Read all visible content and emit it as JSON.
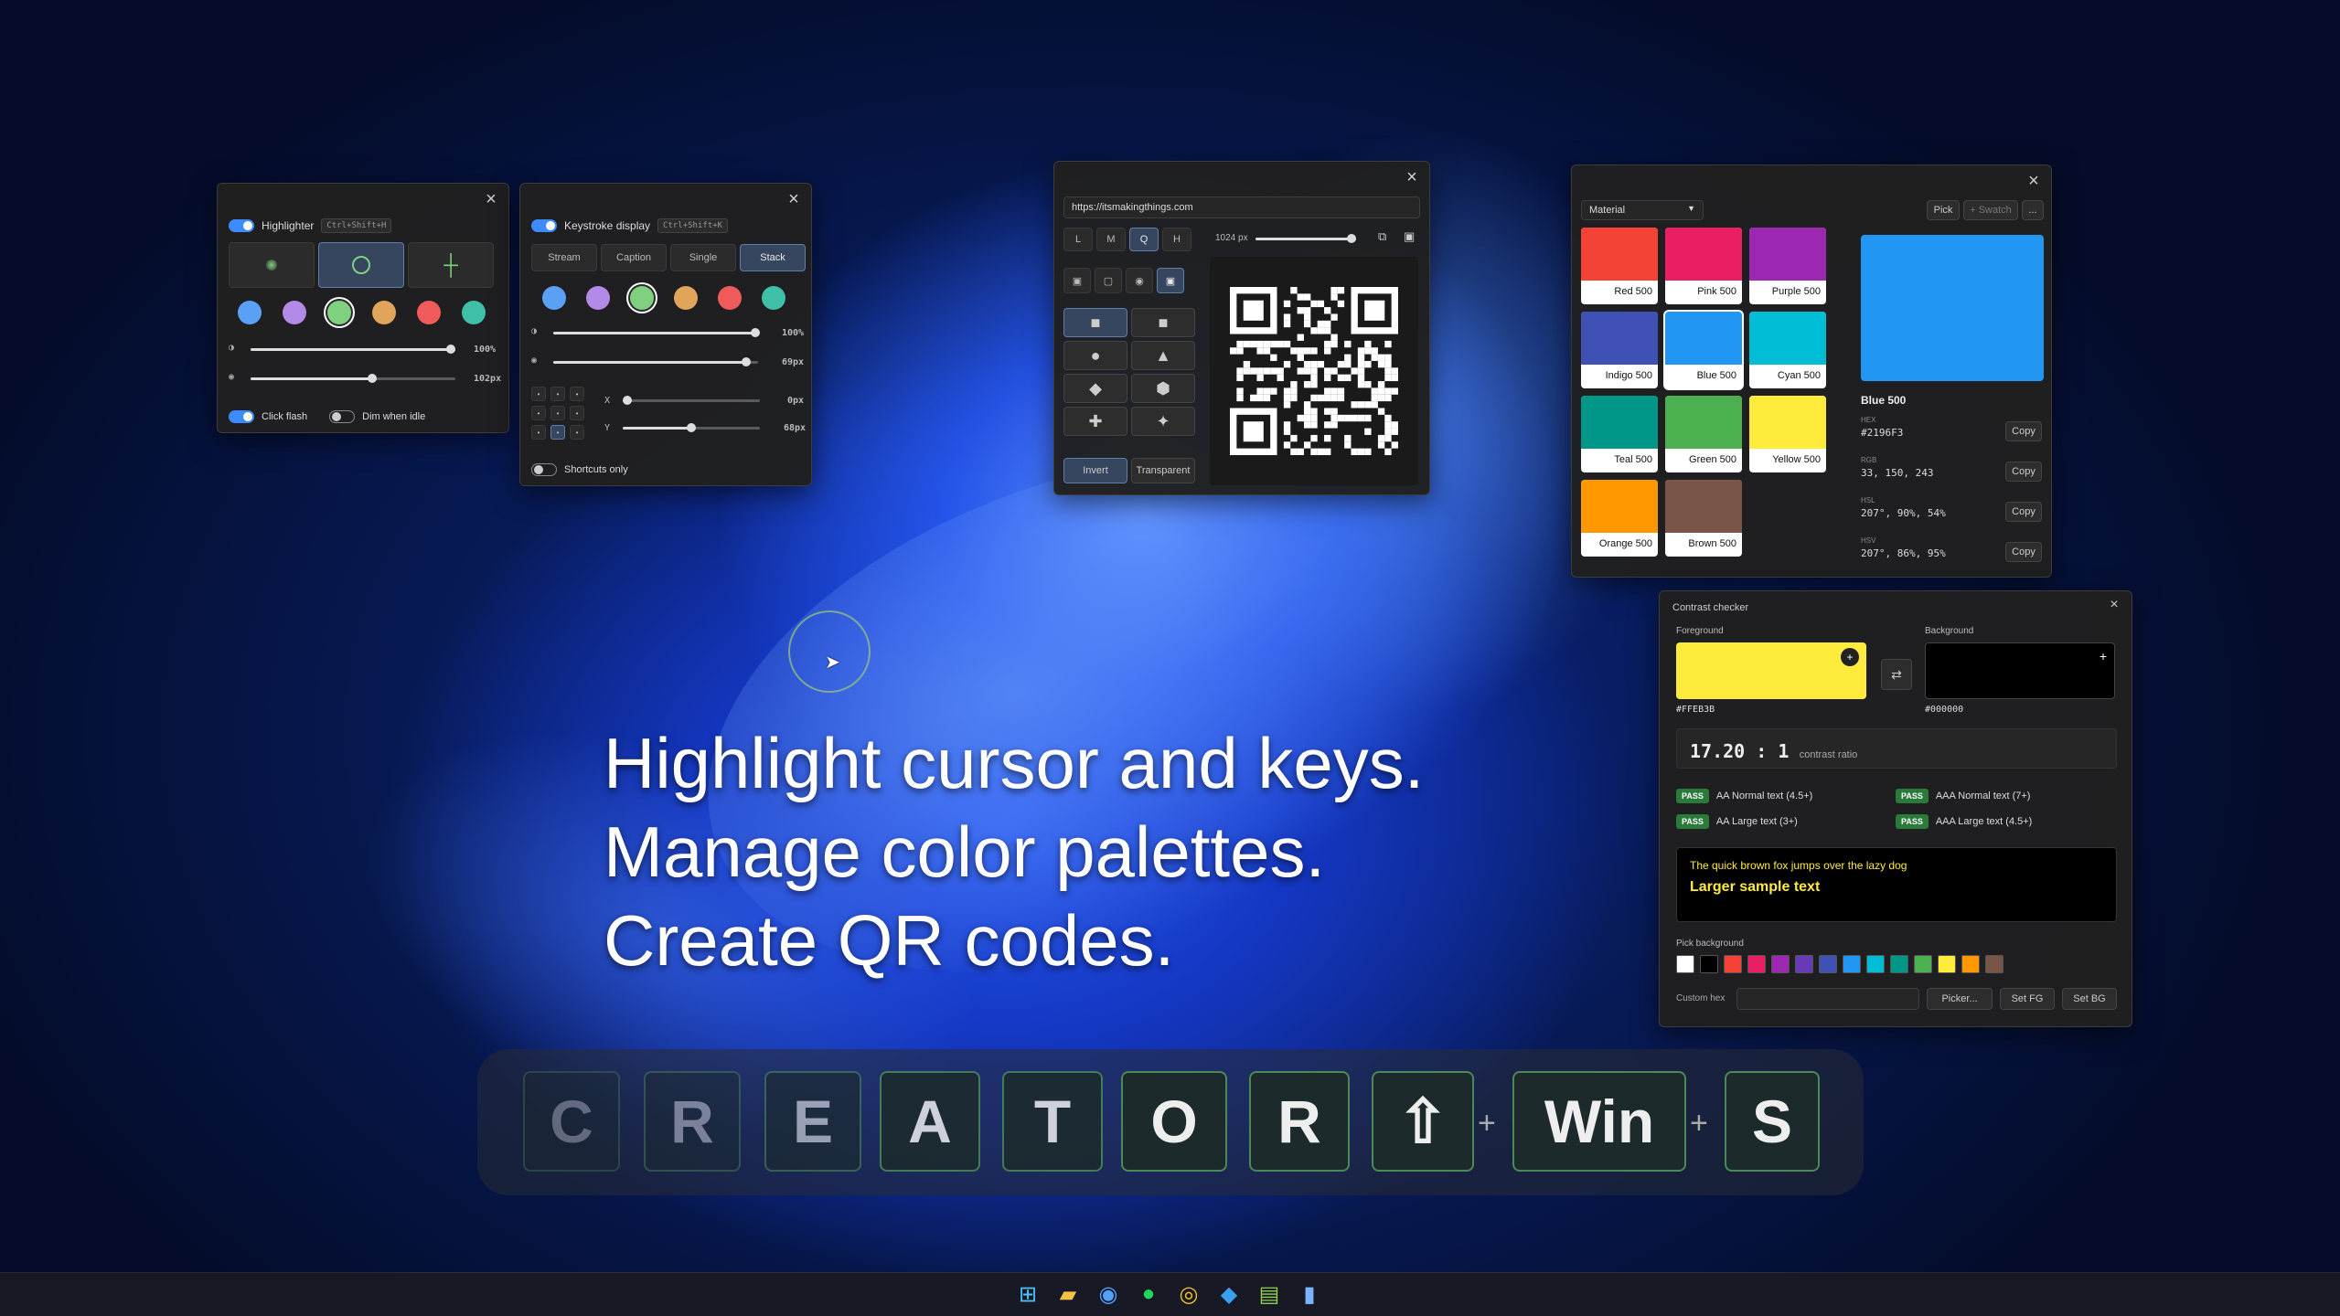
{
  "highlighter": {
    "title": "Highlighter",
    "shortcut": "Ctrl+Shift+H",
    "colors": [
      "#5aa0f5",
      "#b48ae8",
      "#7fd17f",
      "#e0a55a",
      "#ef5a5a",
      "#3fbfa8"
    ],
    "opacity_value": "100%",
    "size_value": "102px",
    "opacity_level": 1.0,
    "size_level": 0.6,
    "click_flash_label": "Click flash",
    "dim_idle_label": "Dim when idle"
  },
  "keystroke": {
    "title": "Keystroke display",
    "shortcut": "Ctrl+Shift+K",
    "modes": [
      "Stream",
      "Caption",
      "Single",
      "Stack"
    ],
    "selected_mode": "Stack",
    "colors": [
      "#5aa0f5",
      "#b48ae8",
      "#7fd17f",
      "#e0a55a",
      "#ef5a5a",
      "#3fbfa8"
    ],
    "opacity_value": "100%",
    "size_value": "69px",
    "x_label": "X",
    "x_value": "0px",
    "y_label": "Y",
    "y_value": "68px",
    "shortcuts_only_label": "Shortcuts only"
  },
  "qr": {
    "url": "https://itsmakingthings.com",
    "ec_levels": [
      "L",
      "M",
      "Q",
      "H"
    ],
    "selected_level": "Q",
    "size_value": "1024 px",
    "size_level": 1.0,
    "invert_label": "Invert",
    "transparent_label": "Transparent"
  },
  "palette": {
    "dropdown": "Material",
    "pick_label": "Pick",
    "swatch_label": "+ Swatch",
    "more_label": "...",
    "swatches": [
      {
        "name": "Red 500",
        "color": "#F44336"
      },
      {
        "name": "Pink 500",
        "color": "#E91E63"
      },
      {
        "name": "Purple 500",
        "color": "#9C27B0"
      },
      {
        "name": "Indigo 500",
        "color": "#3F51B5"
      },
      {
        "name": "Blue 500",
        "color": "#2196F3"
      },
      {
        "name": "Cyan 500",
        "color": "#00BCD4"
      },
      {
        "name": "Teal 500",
        "color": "#009688"
      },
      {
        "name": "Green 500",
        "color": "#4CAF50"
      },
      {
        "name": "Yellow 500",
        "color": "#FFEB3B"
      },
      {
        "name": "Orange 500",
        "color": "#FF9800"
      },
      {
        "name": "Brown 500",
        "color": "#795548"
      }
    ],
    "selected_name": "Blue 500",
    "selected_color": "#2196F3",
    "hex_label": "HEX",
    "hex_value": "#2196F3",
    "rgb_label": "RGB",
    "rgb_value": "33, 150, 243",
    "hsl_label": "HSL",
    "hsl_value": "207°, 90%, 54%",
    "hsv_label": "HSV",
    "hsv_value": "207°, 86%, 95%",
    "copy_label": "Copy"
  },
  "contrast": {
    "title": "Contrast checker",
    "fg_label": "Foreground",
    "bg_label": "Background",
    "fg_value": "#FFEB3B",
    "bg_value": "#000000",
    "fg_color": "#FFEB3B",
    "bg_color": "#000000",
    "swap_icon": "⇄",
    "ratio": "17.20 : 1",
    "ratio_label": "contrast ratio",
    "pass_label": "PASS",
    "checks": [
      "AA Normal text (4.5+)",
      "AAA Normal text (7+)",
      "AA Large text (3+)",
      "AAA Large text (4.5+)"
    ],
    "sample_small": "The quick brown fox jumps over the lazy dog",
    "sample_large": "Larger sample text",
    "pick_bg_label": "Pick background",
    "bg_swatches": [
      "#ffffff",
      "#000000",
      "#F44336",
      "#E91E63",
      "#9C27B0",
      "#673AB7",
      "#3F51B5",
      "#2196F3",
      "#00BCD4",
      "#009688",
      "#4CAF50",
      "#FFEB3B",
      "#FF9800",
      "#795548"
    ],
    "custom_hex_label": "Custom hex",
    "picker_label": "Picker...",
    "set_fg_label": "Set FG",
    "set_bg_label": "Set BG"
  },
  "hero": {
    "line1": "Highlight cursor and keys.",
    "line2": "Manage color palettes.",
    "line3": "Create QR codes."
  },
  "keys": {
    "letters": [
      "C",
      "R",
      "E",
      "A",
      "T",
      "O",
      "R",
      "⇧",
      "Win",
      "S"
    ],
    "plus": "+"
  },
  "taskbar": {
    "icons": [
      "windows-start-icon",
      "file-explorer-icon",
      "browser-icon",
      "spotify-icon",
      "chrome-icon",
      "vscode-icon",
      "notepad-icon",
      "creator-app-icon"
    ]
  }
}
